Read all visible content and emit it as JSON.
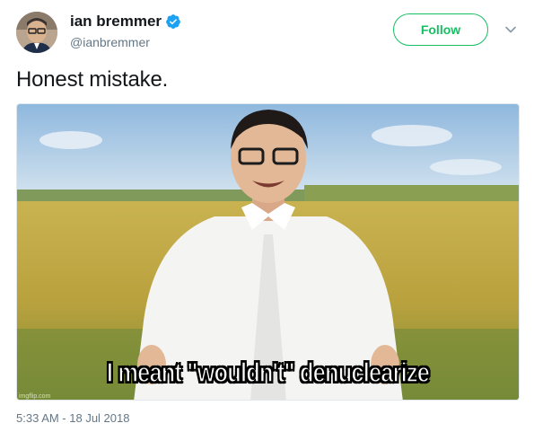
{
  "author": {
    "display_name": "ian bremmer",
    "handle": "@ianbremmer",
    "verified": true
  },
  "follow_label": "Follow",
  "tweet_text": "Honest mistake.",
  "media": {
    "caption": "I meant \"wouldn't\" denuclearize",
    "watermark": "imgflip.com"
  },
  "timestamp": "5:33 AM - 18 Jul 2018",
  "colors": {
    "follow_green": "#17bf63",
    "verified_blue": "#1da1f2",
    "secondary_text": "#657786"
  }
}
